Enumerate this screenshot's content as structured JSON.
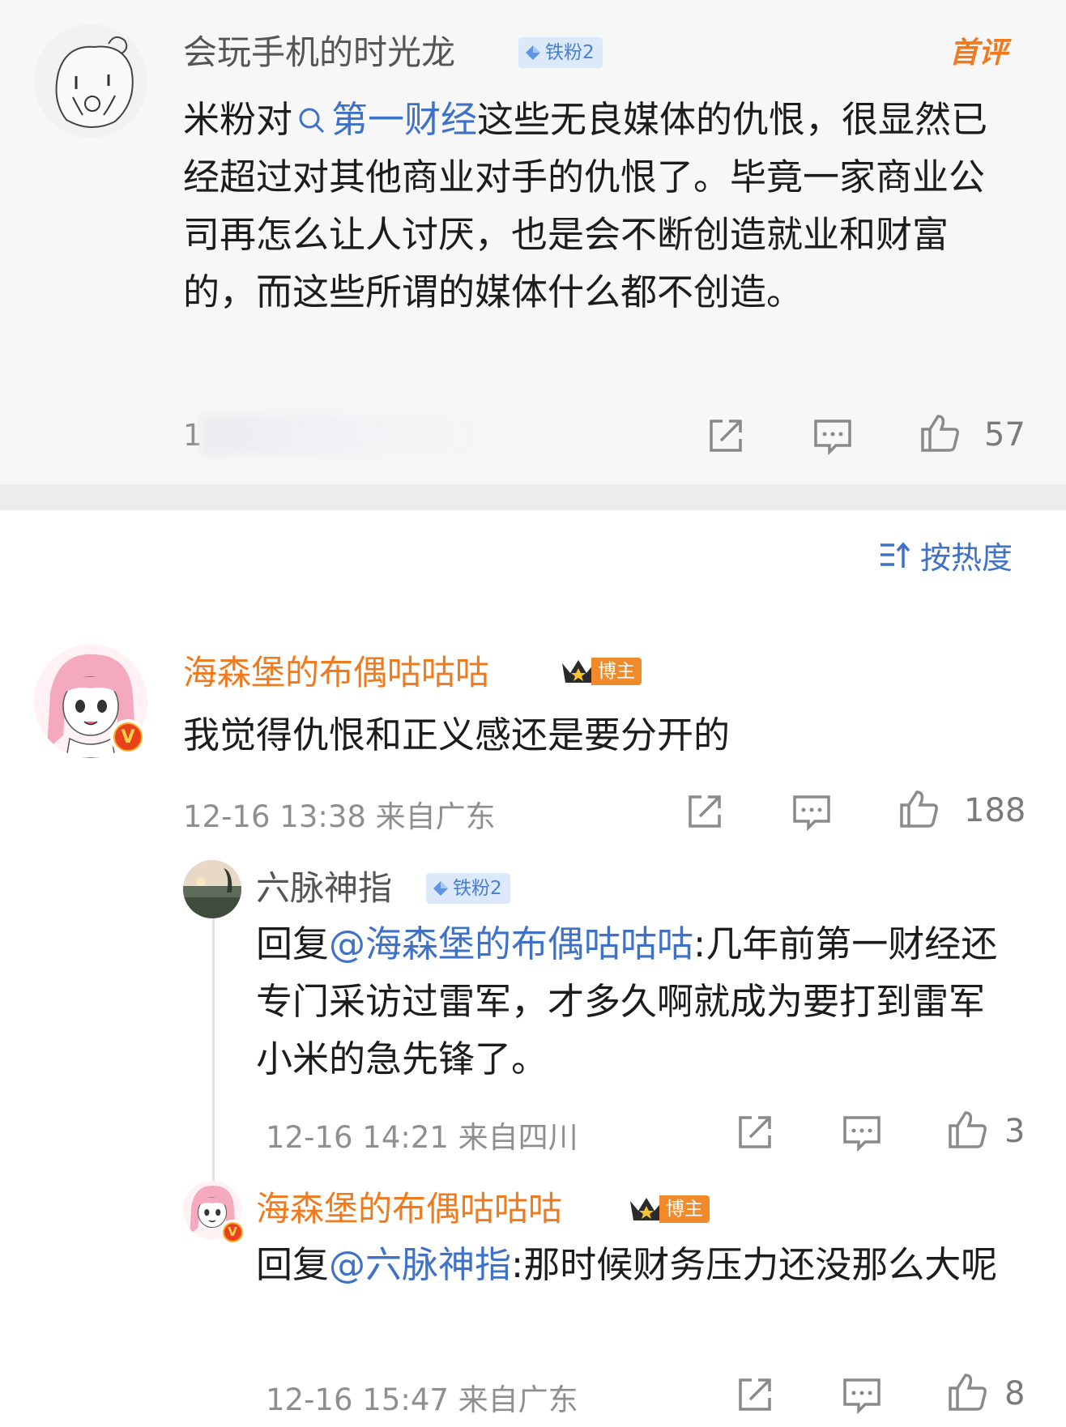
{
  "colors": {
    "accent_blue": "#3f72c6",
    "username_orange": "#f07a1e",
    "meta_grey": "#8f8f8f"
  },
  "top_comment": {
    "username": "会玩手机的时光龙",
    "fan_badge": "铁粉2",
    "first_tag": "首评",
    "text_before": "米粉对",
    "link": "第一财经",
    "text_after": "这些无良媒体的仇恨，很显然已经超过对其他商业对手的仇恨了。毕竟一家商业公司再怎么让人讨厌，也是会不断创造就业和财富的，而这些所谓的媒体什么都不创造。",
    "meta_visible": "1",
    "likes": "57"
  },
  "sort_label": "按热度",
  "comment": {
    "username": "海森堡的布偶咕咕咕",
    "host_badge": "博主",
    "text": "我觉得仇恨和正义感还是要分开的",
    "meta": "12-16 13:38 来自广东",
    "likes": "188"
  },
  "replies": [
    {
      "username": "六脉神指",
      "fan_badge": "铁粉2",
      "prefix": "回复",
      "mention": "@海森堡的布偶咕咕咕",
      "text": ":几年前第一财经还专门采访过雷军，才多久啊就成为要打到雷军小米的急先锋了。",
      "meta": "12-16 14:21 来自四川",
      "likes": "3"
    },
    {
      "username": "海森堡的布偶咕咕咕",
      "host_badge": "博主",
      "prefix": "回复",
      "mention": "@六脉神指",
      "text": ":那时候财务压力还没那么大呢",
      "meta": "12-16 15:47 来自广东",
      "likes": "8"
    }
  ],
  "icons": [
    "search-icon",
    "repost-icon",
    "comment-icon",
    "like-icon",
    "sort-icon",
    "diamond-icon",
    "crown-icon",
    "verified-icon"
  ]
}
